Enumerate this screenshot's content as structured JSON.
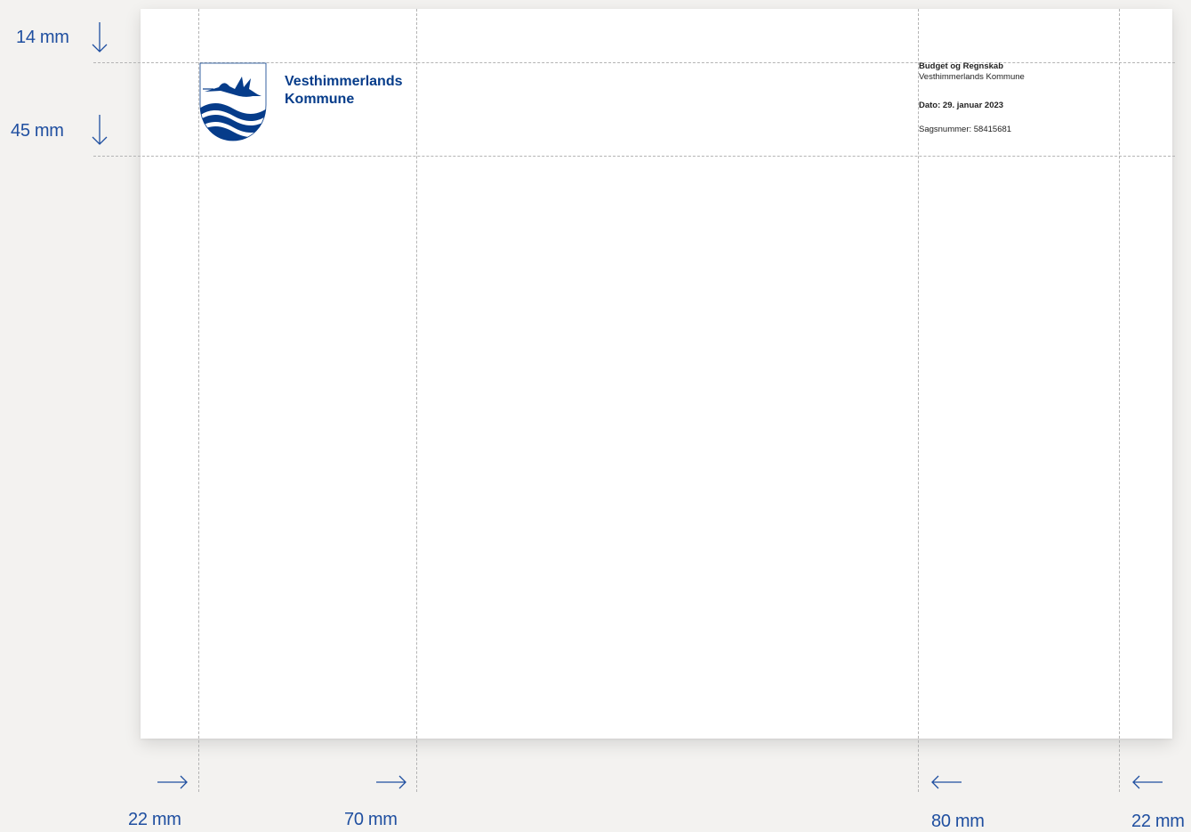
{
  "brand": {
    "line1": "Vesthimmerlands",
    "line2": "Kommune"
  },
  "letter_meta": {
    "department": "Budget og Regnskab",
    "organization": "Vesthimmerlands Kommune",
    "date": "Dato: 29. januar 2023",
    "case_number": "Sagsnummer: 58415681"
  },
  "measurements": {
    "top_margin": "14 mm",
    "header_height": "45 mm",
    "left_margin": "22 mm",
    "left_column": "70 mm",
    "right_column": "80 mm",
    "right_margin": "22 mm"
  },
  "colors": {
    "accent": "#1f4fa0",
    "brand": "#063c8a",
    "guide": "#b4b4b4",
    "background": "#f3f2f0"
  },
  "icons": [
    "arrow-down-icon",
    "arrow-right-icon",
    "arrow-left-icon",
    "coat-of-arms-logo"
  ]
}
